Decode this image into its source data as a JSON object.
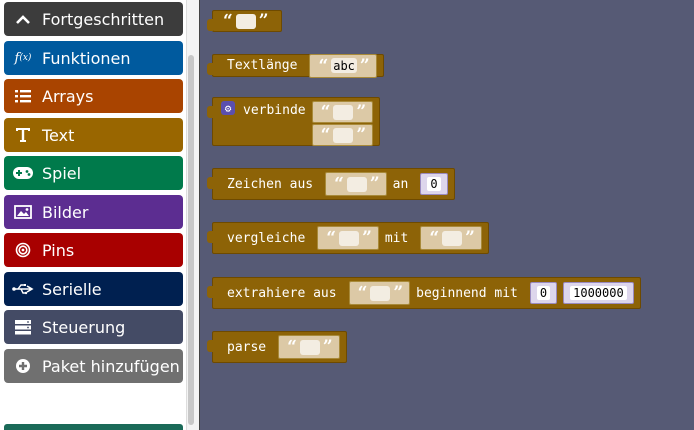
{
  "sidebar": {
    "categories": [
      {
        "label": "Fortgeschritten",
        "icon": "chevron-up-icon",
        "color": "#3c3c3c"
      },
      {
        "label": "Funktionen",
        "icon": "function-icon",
        "color": "#005a9e"
      },
      {
        "label": "Arrays",
        "icon": "list-icon",
        "color": "#a94400"
      },
      {
        "label": "Text",
        "icon": "text-icon",
        "color": "#996600"
      },
      {
        "label": "Spiel",
        "icon": "gamepad-icon",
        "color": "#007a4b"
      },
      {
        "label": "Bilder",
        "icon": "image-icon",
        "color": "#5c2d91"
      },
      {
        "label": "Pins",
        "icon": "pins-icon",
        "color": "#a80000"
      },
      {
        "label": "Serielle",
        "icon": "usb-icon",
        "color": "#002050"
      },
      {
        "label": "Steuerung",
        "icon": "server-icon",
        "color": "#444b65"
      },
      {
        "label": "Paket hinzufügen",
        "icon": "plus-circle-icon",
        "color": "#707070"
      }
    ]
  },
  "blocks": {
    "empty_string": {
      "value": ""
    },
    "text_length": {
      "label": "Textlänge",
      "value": "abc"
    },
    "join": {
      "label": "verbinde",
      "value1": "",
      "value2": ""
    },
    "char_at": {
      "label": "Zeichen aus",
      "value": "",
      "mid": "an",
      "index": "0"
    },
    "compare": {
      "label": "vergleiche",
      "value1": "",
      "mid": "mit",
      "value2": ""
    },
    "substr": {
      "label": "extrahiere aus",
      "value": "",
      "mid": "beginnend mit",
      "start": "0",
      "length": "1000000"
    },
    "parse": {
      "label": "parse",
      "value": ""
    }
  },
  "quotes": {
    "open": "“",
    "close": "”"
  },
  "colors": {
    "text_block": "#8d6307",
    "workspace": "#565a75"
  }
}
